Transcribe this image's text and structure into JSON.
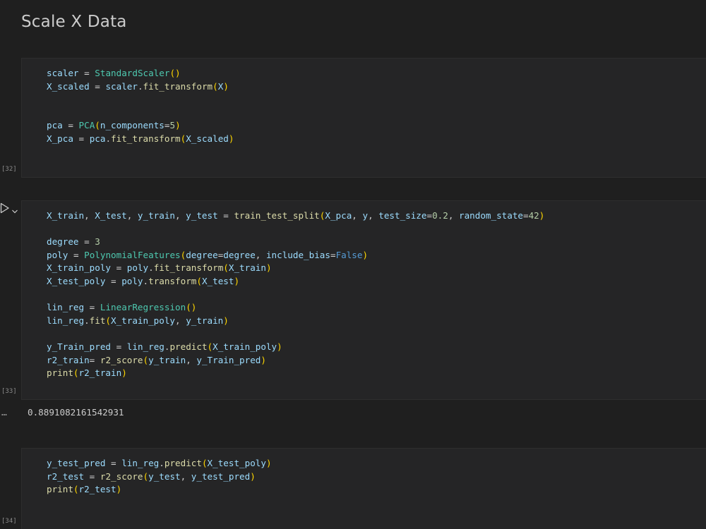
{
  "heading": "Scale X Data",
  "cells": [
    {
      "execution_count": "[32]",
      "code_lines": [
        "scaler = StandardScaler()",
        "X_scaled = scaler.fit_transform(X)",
        "",
        "",
        "pca = PCA(n_components=5)",
        "X_pca = pca.fit_transform(X_scaled)"
      ]
    },
    {
      "execution_count": "[33]",
      "code_lines": [
        "X_train, X_test, y_train, y_test = train_test_split(X_pca, y, test_size=0.2, random_state=42)",
        "",
        "degree = 3",
        "poly = PolynomialFeatures(degree=degree, include_bias=False)",
        "X_train_poly = poly.fit_transform(X_train)",
        "X_test_poly = poly.transform(X_test)",
        "",
        "lin_reg = LinearRegression()",
        "lin_reg.fit(X_train_poly, y_train)",
        "",
        "y_Train_pred = lin_reg.predict(X_train_poly)",
        "r2_train= r2_score(y_train, y_Train_pred)",
        "print(r2_train)"
      ],
      "output": "0.8891082161542931",
      "output_menu": "…"
    },
    {
      "execution_count": "[34]",
      "code_lines": [
        "y_test_pred = lin_reg.predict(X_test_poly)",
        "r2_test = r2_score(y_test, y_test_pred)",
        "print(r2_test)"
      ]
    }
  ],
  "icons": {
    "run": "run-cell-icon",
    "chevron": "chevron-down-icon"
  },
  "colors": {
    "background": "#1f1f1f",
    "cell_background": "#252526",
    "variable": "#9cdcfe",
    "class": "#4ec9b0",
    "function": "#dcdcaa",
    "number": "#b5cea8",
    "bracket": "#ffd700"
  }
}
